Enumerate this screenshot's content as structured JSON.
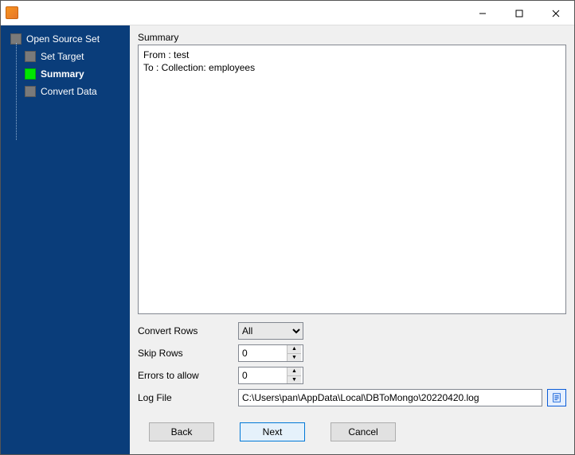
{
  "nav": {
    "root": "Open Source Set",
    "children": [
      {
        "label": "Set Target",
        "active": false
      },
      {
        "label": "Summary",
        "active": true
      },
      {
        "label": "Convert Data",
        "active": false
      }
    ]
  },
  "summary": {
    "title": "Summary",
    "from_line": "From : test",
    "to_line": "To : Collection: employees"
  },
  "form": {
    "convert_rows_label": "Convert Rows",
    "convert_rows_value": "All",
    "skip_rows_label": "Skip Rows",
    "skip_rows_value": "0",
    "errors_label": "Errors to allow",
    "errors_value": "0",
    "logfile_label": "Log File",
    "logfile_value": "C:\\Users\\pan\\AppData\\Local\\DBToMongo\\20220420.log"
  },
  "buttons": {
    "back": "Back",
    "next": "Next",
    "cancel": "Cancel"
  }
}
